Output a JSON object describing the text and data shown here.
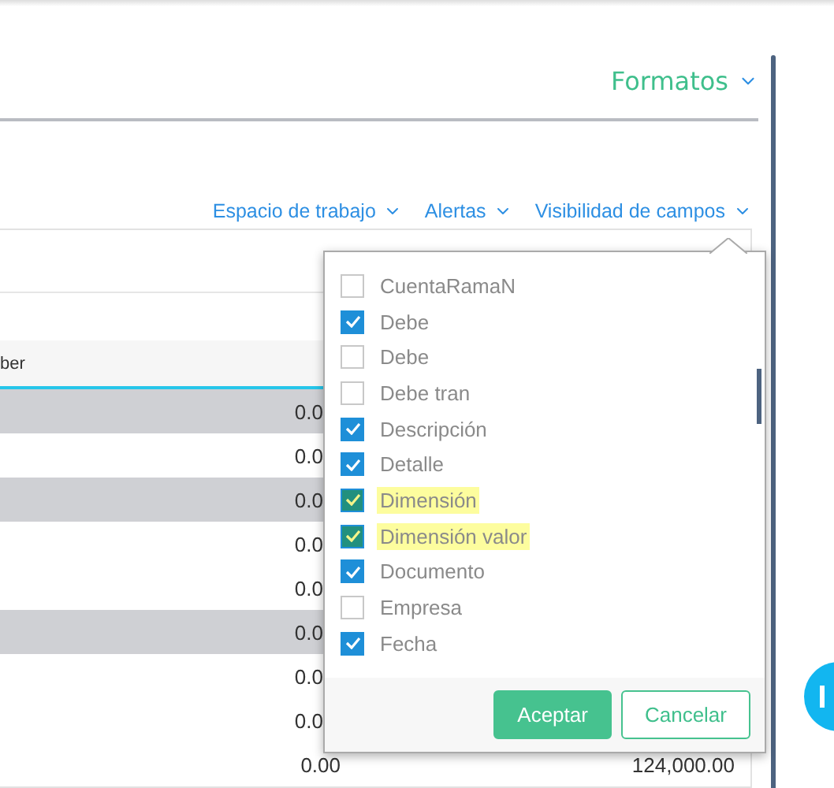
{
  "header": {
    "menu": "Formatos"
  },
  "toolbar": [
    "Espacio de trabajo",
    "Alertas",
    "Visibilidad de campos"
  ],
  "table": {
    "column_header": "ber",
    "rows": [
      {
        "shaded": true,
        "cells": [
          "0.0"
        ]
      },
      {
        "shaded": false,
        "cells": [
          "0.0"
        ]
      },
      {
        "shaded": true,
        "cells": [
          "0.0"
        ]
      },
      {
        "shaded": false,
        "cells": [
          "0.0"
        ]
      },
      {
        "shaded": false,
        "cells": [
          "0.0"
        ]
      },
      {
        "shaded": true,
        "cells": [
          "0.0"
        ]
      },
      {
        "shaded": false,
        "cells": [
          "0.0"
        ]
      },
      {
        "shaded": false,
        "cells": [
          "0.0"
        ]
      },
      {
        "shaded": false,
        "cells": [
          "0.00",
          "124,000.00"
        ]
      }
    ]
  },
  "field_menu": {
    "items": [
      {
        "label": "CuentaRamaN",
        "checked": false,
        "highlighted": false
      },
      {
        "label": "Debe",
        "checked": true,
        "highlighted": false
      },
      {
        "label": "Debe",
        "checked": false,
        "highlighted": false
      },
      {
        "label": "Debe tran",
        "checked": false,
        "highlighted": false
      },
      {
        "label": "Descripción",
        "checked": true,
        "highlighted": false
      },
      {
        "label": "Detalle",
        "checked": true,
        "highlighted": false
      },
      {
        "label": "Dimensión",
        "checked": true,
        "highlighted": true
      },
      {
        "label": "Dimensión valor",
        "checked": true,
        "highlighted": true
      },
      {
        "label": "Documento",
        "checked": true,
        "highlighted": false
      },
      {
        "label": "Empresa",
        "checked": false,
        "highlighted": false
      },
      {
        "label": "Fecha",
        "checked": true,
        "highlighted": false
      }
    ],
    "buttons": [
      {
        "label": "Aceptar",
        "kind": "primary"
      },
      {
        "label": "Cancelar",
        "kind": "secondary"
      }
    ]
  }
}
